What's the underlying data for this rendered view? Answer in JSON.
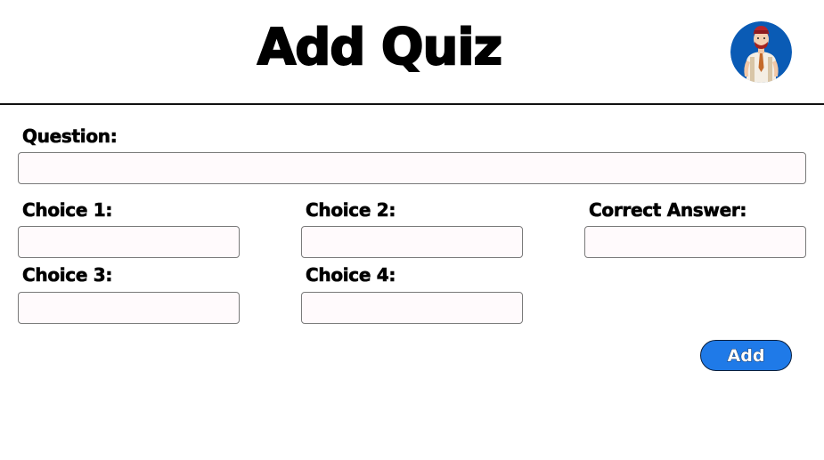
{
  "header": {
    "title": "Add Quiz",
    "avatar_icon": "user-avatar-icon"
  },
  "form": {
    "question_label": "Question:",
    "question_value": "",
    "choice1_label": "Choice 1:",
    "choice1_value": "",
    "choice2_label": "Choice 2:",
    "choice2_value": "",
    "correct_answer_label": "Correct Answer:",
    "correct_answer_value": "",
    "choice3_label": "Choice 3:",
    "choice3_value": "",
    "choice4_label": "Choice 4:",
    "choice4_value": "",
    "add_button_label": "Add"
  },
  "colors": {
    "accent": "#1f7ae8",
    "avatar_background": "#0a5bb5",
    "field_background": "#fffafc"
  }
}
